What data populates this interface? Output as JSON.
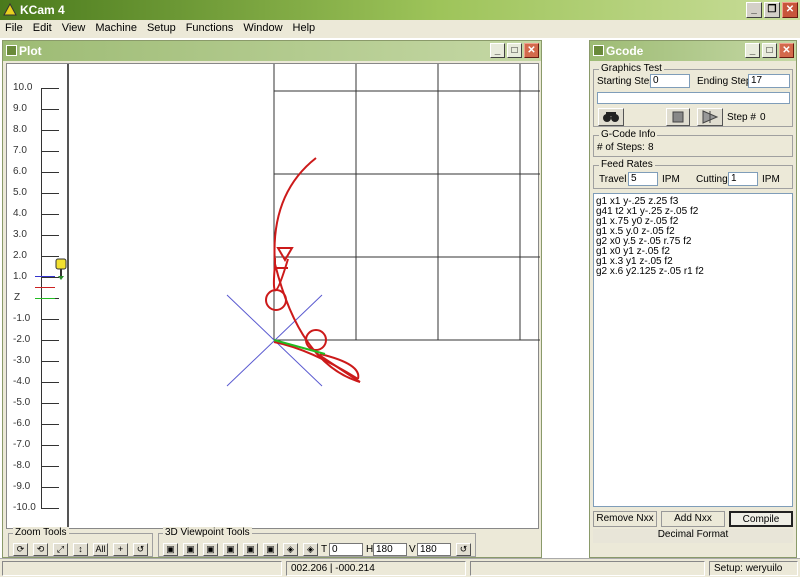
{
  "app": {
    "title": "KCam 4"
  },
  "menu": [
    "File",
    "Edit",
    "View",
    "Machine",
    "Setup",
    "Functions",
    "Window",
    "Help"
  ],
  "plot": {
    "title": "Plot",
    "ruler_labels": [
      "10.0",
      "9.0",
      "8.0",
      "7.0",
      "6.0",
      "5.0",
      "4.0",
      "3.0",
      "2.0",
      "1.0",
      "Z",
      "-1.0",
      "-2.0",
      "-3.0",
      "-4.0",
      "-5.0",
      "-6.0",
      "-7.0",
      "-8.0",
      "-9.0",
      "-10.0"
    ],
    "zoom_tools_label": "Zoom Tools",
    "viewpoint_tools_label": "3D Viewpoint Tools",
    "spin_t": "0",
    "spin_h": "180",
    "spin_v": "180",
    "label_t": "T",
    "label_h": "H",
    "label_v": "V",
    "zoom_all_label": "All"
  },
  "gcode": {
    "title": "Gcode",
    "graphics_test_label": "Graphics Test",
    "starting_step_label": "Starting Step:",
    "starting_step": "0",
    "ending_step_label": "Ending Step:",
    "ending_step": "17",
    "step_label": "Step #",
    "step_value": "0",
    "info_label": "G-Code Info",
    "steps_label": "# of Steps:",
    "steps_value": "8",
    "feed_label": "Feed Rates",
    "travel_label": "Travel",
    "travel_value": "5",
    "travel_unit": "IPM",
    "cutting_label": "Cutting",
    "cutting_value": "1",
    "cutting_unit": "IPM",
    "lines": [
      "g1 x1 y-.25 z.25 f3",
      "g41 t2  x1 y-.25 z-.05 f2",
      "g1 x.75 y0 z-.05 f2",
      "g1 x.5 y.0 z-.05 f2",
      "g2 x0 y.5 z-.05 r.75 f2",
      "g1 x0 y1 z-.05 f2",
      "g1 x.3 y1 z-.05 f2",
      "g2 x.6 y2.125 z-.05 r1 f2"
    ],
    "remove_btn": "Remove  Nxx",
    "add_btn": "Add Nxx",
    "compile_btn": "Compile",
    "format_label": "Decimal Format"
  },
  "status": {
    "coords": "002.206 | -000.214",
    "setup": "Setup: weryuilo"
  },
  "colors": {
    "path": "#cc1a1a",
    "cross": "#5a5ad0",
    "grid": "#333333",
    "tool_path": "#22bb22"
  }
}
